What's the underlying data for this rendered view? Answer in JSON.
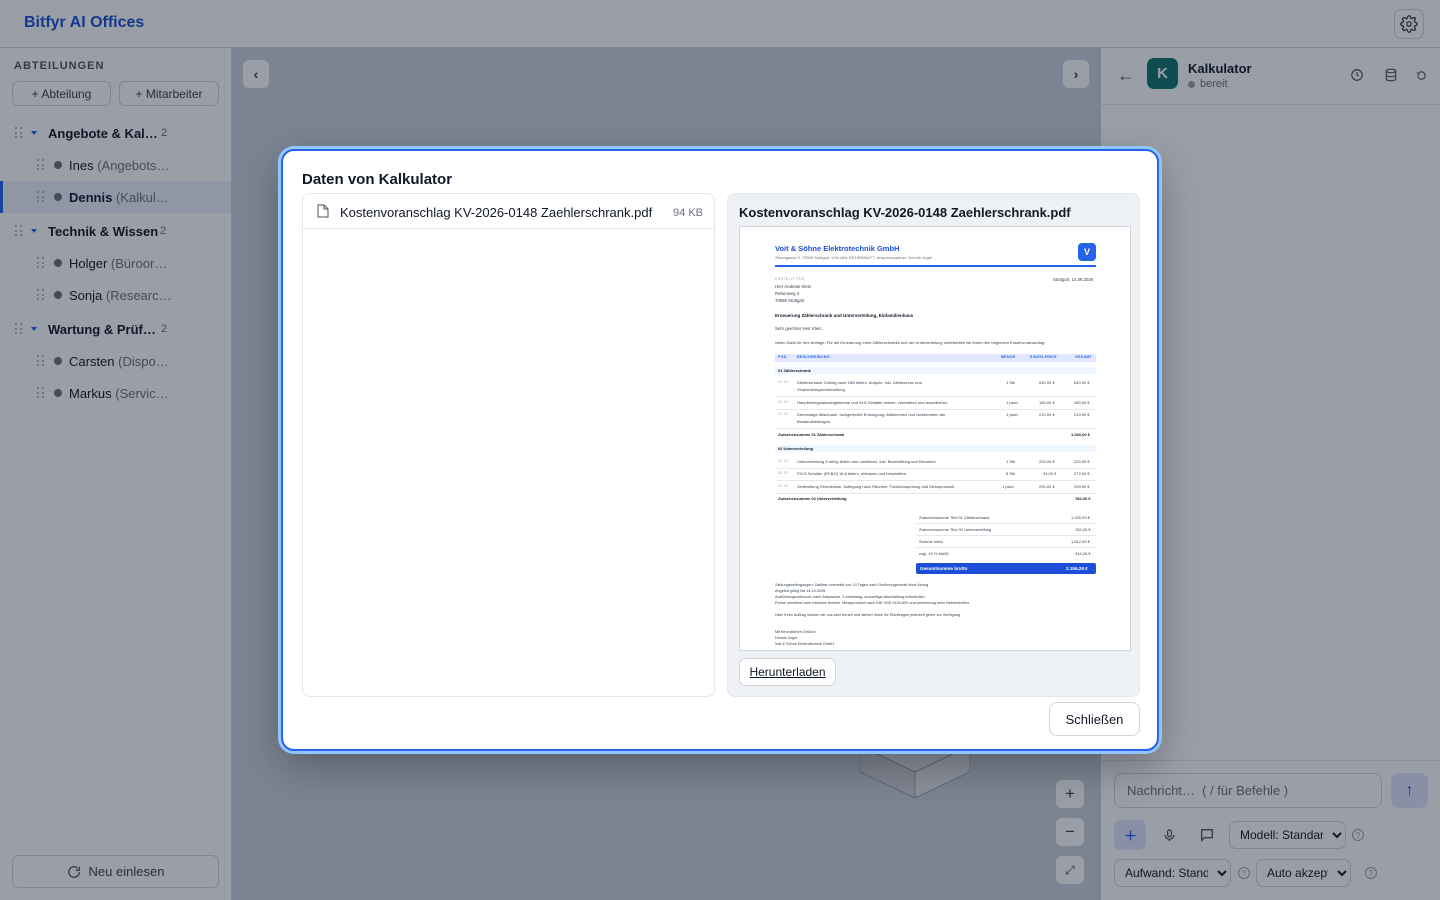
{
  "app": {
    "title": "Bitfyr AI Offices"
  },
  "sidebar": {
    "section_title": "ABTEILUNGEN",
    "add_department": "+ Abteilung",
    "add_employee": "+ Mitarbeiter",
    "groups": [
      {
        "label": "Angebote & Kal…",
        "count": "2",
        "members": [
          {
            "name": "Ines",
            "role": "(Angebots…"
          },
          {
            "name": "Dennis",
            "role": "(Kalkul…"
          }
        ]
      },
      {
        "label": "Technik & Wissen",
        "count": "2",
        "members": [
          {
            "name": "Holger",
            "role": "(Büroor…"
          },
          {
            "name": "Sonja",
            "role": "(Researc…"
          }
        ]
      },
      {
        "label": "Wartung & Prüf…",
        "count": "2",
        "members": [
          {
            "name": "Carsten",
            "role": "(Dispo…"
          },
          {
            "name": "Markus",
            "role": "(Servic…"
          }
        ]
      }
    ],
    "reload": "Neu einlesen"
  },
  "canvas": {
    "prev": "‹",
    "next": "›"
  },
  "chat": {
    "back": "←",
    "avatar_letter": "K",
    "agent_name": "Kalkulator",
    "agent_status": "bereit",
    "input_placeholder": "Nachricht…  ( / für Befehle )",
    "model_select": "Modell: Standard",
    "effort_select": "Aufwand: Standa",
    "approve_select": "Auto akzept."
  },
  "modal": {
    "title": "Daten von Kalkulator",
    "files": [
      {
        "name": "Kostenvoranschlag KV-2026-0148 Zaehlerschrank.pdf",
        "size": "94 KB"
      }
    ],
    "preview_title": "Kostenvoranschlag KV-2026-0148 Zaehlerschrank.pdf",
    "download": "Herunterladen",
    "close": "Schließen"
  },
  "pdf": {
    "company": "Voit & Söhne Elektrotechnik GmbH",
    "logo_letter": "V",
    "company_address": "Stromgasse 5, 70565 Stuttgart, USt-IdNr. DE189884477, Ansprechpartner: Dennis Vogel",
    "prepared_for": "ERSTELLT FÜR",
    "date": "Stuttgart, 14.09.2026",
    "recipient": [
      "Herr Andreas Klein",
      "Rebenweg 3",
      "70599 Stuttgart"
    ],
    "subject": "Erneuerung Zählerschrank und Unterverteilung, Einfamilienhaus",
    "greeting": "Sehr geehrter Herr Klein,",
    "intro": "vielen Dank für Ihre Anfrage. Für die Erneuerung Ihres Zählerschranks und der Unterverteilung unterbreiten wir Ihnen den folgenden Kostenvoranschlag.",
    "columns": [
      "POS.",
      "BESCHREIBUNG",
      "MENGE",
      "EINZELPREIS",
      "GESAMT"
    ],
    "sections": [
      {
        "title": "01   Zählerschrank",
        "items": [
          {
            "pos": "01.10",
            "desc": [
              "Zählerschrank 3-feldig nach TAB liefern, Aufputz, inkl. Zählerkreuz und",
              "Verplombungsvorbereitung."
            ],
            "qty": "1 Stk",
            "price": "640,00 €",
            "total": "640,00 €"
          },
          {
            "pos": "01.20",
            "desc": [
              "Hauptleitungsabzweigklemme und SLS-Schalter setzen, verdrahten und anschließen."
            ],
            "qty": "1 psch",
            "price": "180,00 €",
            "total": "180,00 €"
          },
          {
            "pos": "01.30",
            "desc": [
              "Demontage Altschrank, fachgerechte Entsorgung, Abklemmen und Umklemmen der",
              "Bestandsleitungen."
            ],
            "qty": "1 psch",
            "price": "210,00 €",
            "total": "210,00 €"
          }
        ],
        "subtotal_label": "Zwischensumme 01 Zählerschrank",
        "subtotal": "1.030,00 €"
      },
      {
        "title": "02   Unterverteilung",
        "items": [
          {
            "pos": "02.10",
            "desc": [
              "Unterverteilung 3-reihig liefern und montieren, inkl. Beschriftung und Klemmen."
            ],
            "qty": "1 Stk",
            "price": "220,00 €",
            "total": "220,00 €"
          },
          {
            "pos": "02.20",
            "desc": [
              "FI/LS-Schalter (RCBO) 16 A liefern, einbauen und beschriften."
            ],
            "qty": "8 Stk",
            "price": "34,00 €",
            "total": "272,00 €"
          },
          {
            "pos": "02.30",
            "desc": [
              "Verdrahtung Stromkreise, Auflegung nach Räumen, Funktionsprüfung und Messprotokoll."
            ],
            "qty": "1 psch",
            "price": "290,00 €",
            "total": "290,00 €"
          }
        ],
        "subtotal_label": "Zwischensumme 02 Unterverteilung",
        "subtotal": "782,00 €"
      }
    ],
    "summary": [
      {
        "label": "Zwischensumme Titel 01 Zählerschrank",
        "value": "1.030,00 €"
      },
      {
        "label": "Zwischensumme Titel 02 Unterverteilung",
        "value": "782,00 €"
      },
      {
        "label": "Summe netto",
        "value": "1.812,00 €"
      },
      {
        "label": "zzgl. 19 % MwSt",
        "value": "344,28 €"
      }
    ],
    "grand_total_label": "Gesamtsumme brutto",
    "grand_total": "2.156,28 €",
    "terms": [
      "Zahlungsbedingungen: Zahlbar innerhalb von 14 Tagen nach Rechnungserhalt ohne Abzug.",
      "Angebot gültig bis 14.10.2026.",
      "Ausführungszeitraum: nach Absprache, 1 Arbeitstag, kurzzeitige Abschaltung erforderlich.",
      "Preise verstehen sich inklusive Anfahrt, Messprotokoll nach DIN VDE 0100-600 und Anmeldung beim Netzbetreiber."
    ],
    "closing": "Über Ihren Auftrag würden wir uns sehr freuen und stehen Ihnen für Rückfragen jederzeit gerne zur Verfügung.",
    "signature": [
      "Mit freundlichen Grüßen",
      "Dennis Vogel",
      "Voit & Söhne Elektrotechnik GmbH"
    ]
  },
  "colors": {
    "accent": "#2563eb",
    "brand": "#1d4ed8",
    "avatar": "#0f766e"
  }
}
